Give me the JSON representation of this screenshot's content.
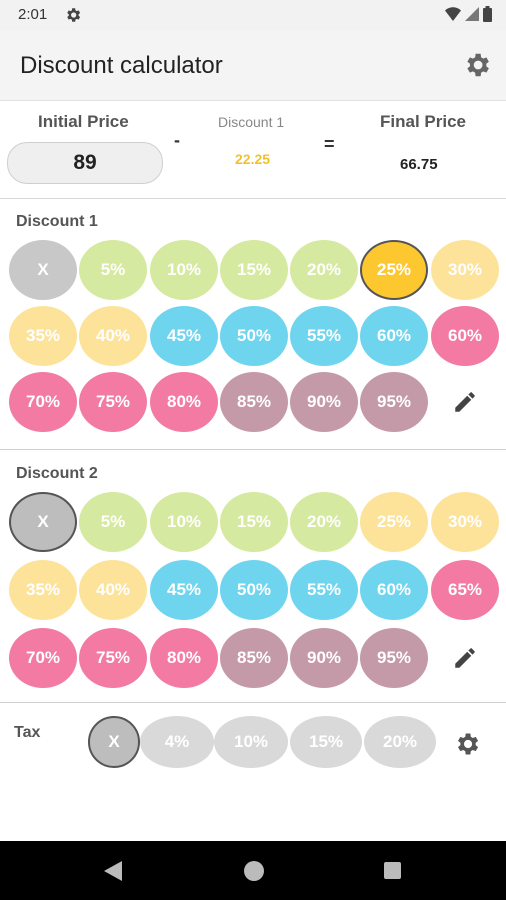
{
  "status_bar": {
    "time": "2:01",
    "icons": [
      "gear-icon",
      "wifi-icon",
      "signal-icon",
      "battery-icon"
    ]
  },
  "app_bar": {
    "title": "Discount calculator",
    "settings_icon": "gear-icon"
  },
  "price": {
    "initial_label": "Initial Price",
    "initial_value": "89",
    "minus": "-",
    "discount_label": "Discount 1",
    "discount_value": "22.25",
    "equals": "=",
    "final_label": "Final Price",
    "final_value": "66.75"
  },
  "discount1": {
    "title": "Discount 1",
    "options": [
      "X",
      "5%",
      "10%",
      "15%",
      "20%",
      "25%",
      "30%",
      "35%",
      "40%",
      "45%",
      "50%",
      "55%",
      "60%",
      "60%",
      "70%",
      "75%",
      "80%",
      "85%",
      "90%",
      "95%"
    ],
    "selected": "25%",
    "edit_icon": "pencil-icon"
  },
  "discount2": {
    "title": "Discount 2",
    "options": [
      "X",
      "5%",
      "10%",
      "15%",
      "20%",
      "25%",
      "30%",
      "35%",
      "40%",
      "45%",
      "50%",
      "55%",
      "60%",
      "65%",
      "70%",
      "75%",
      "80%",
      "85%",
      "90%",
      "95%"
    ],
    "selected": "X",
    "edit_icon": "pencil-icon"
  },
  "tax": {
    "title": "Tax",
    "options": [
      "X",
      "4%",
      "10%",
      "15%",
      "20%"
    ],
    "selected": "X",
    "settings_icon": "gear-icon"
  },
  "colors": {
    "green": "#d6e9a0",
    "yellow": "#fde39a",
    "blue": "#6fd5ef",
    "pink": "#f37ba3",
    "mauve": "#c49aa8",
    "gray": "#c8c8c8",
    "selected_gold": "#fdc82f",
    "discount_text": "#f2c22a"
  },
  "nav_bar": {
    "icons": [
      "back-icon",
      "home-icon",
      "recents-icon"
    ]
  }
}
